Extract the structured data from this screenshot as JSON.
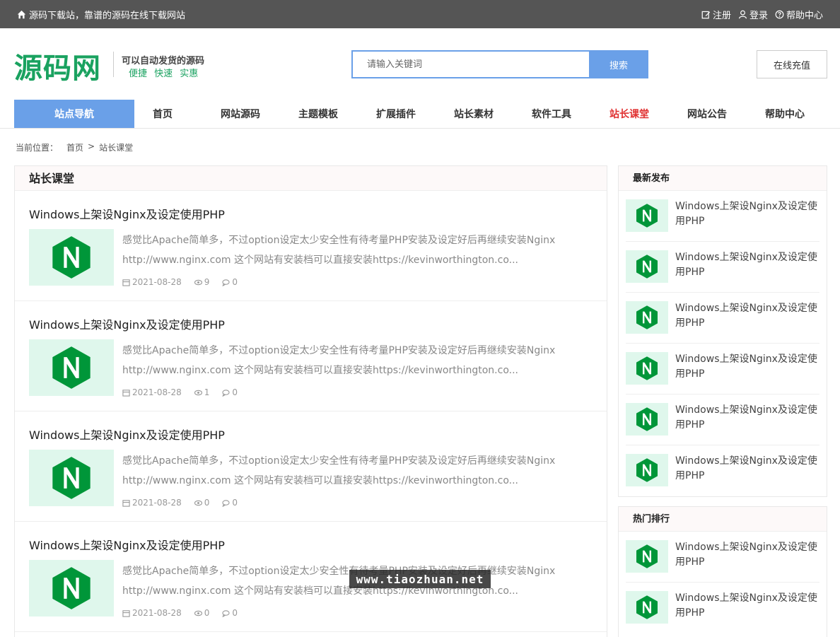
{
  "topbar": {
    "slogan": "源码下载站，靠谱的源码在线下载网站",
    "register": "注册",
    "login": "登录",
    "help": "帮助中心"
  },
  "header": {
    "logo": "源码网",
    "slogan_line1": "可以自动发货的源码",
    "slogan_line2": "便捷 快速 实惠",
    "search_placeholder": "请输入关键词",
    "search_button": "搜索",
    "recharge_button": "在线充值"
  },
  "nav": {
    "site_nav": "站点导航",
    "items": [
      "首页",
      "网站源码",
      "主题模板",
      "扩展插件",
      "站长素材",
      "软件工具",
      "站长课堂",
      "网站公告",
      "帮助中心"
    ],
    "active_index": 6,
    "active_color": "#e03030"
  },
  "breadcrumb": {
    "label": "当前位置：",
    "home": "首页",
    "separator": ">",
    "current": "站长课堂"
  },
  "main": {
    "title": "站长课堂",
    "posts": [
      {
        "title": "Windows上架设Nginx及设定使用PHP",
        "excerpt": "感觉比Apache简单多，不过option设定太少安全性有待考量PHP安装及设定好后再继续安装Nginx http://www.nginx.com 这个网站有安装档可以直接安装https://kevinworthington.co...",
        "date": "2021-08-28",
        "views": "9",
        "comments": "0"
      },
      {
        "title": "Windows上架设Nginx及设定使用PHP",
        "excerpt": "感觉比Apache简单多，不过option设定太少安全性有待考量PHP安装及设定好后再继续安装Nginx http://www.nginx.com 这个网站有安装档可以直接安装https://kevinworthington.co...",
        "date": "2021-08-28",
        "views": "1",
        "comments": "0"
      },
      {
        "title": "Windows上架设Nginx及设定使用PHP",
        "excerpt": "感觉比Apache简单多，不过option设定太少安全性有待考量PHP安装及设定好后再继续安装Nginx http://www.nginx.com 这个网站有安装档可以直接安装https://kevinworthington.co...",
        "date": "2021-08-28",
        "views": "0",
        "comments": "0"
      },
      {
        "title": "Windows上架设Nginx及设定使用PHP",
        "excerpt": "感觉比Apache简单多，不过option设定太少安全性有待考量PHP安装及设定好后再继续安装Nginx http://www.nginx.com 这个网站有安装档可以直接安装https://kevinworthington.co...",
        "date": "2021-08-28",
        "views": "0",
        "comments": "0"
      }
    ]
  },
  "sidebar": {
    "latest_title": "最新发布",
    "latest": [
      "Windows上架设Nginx及设定使用PHP",
      "Windows上架设Nginx及设定使用PHP",
      "Windows上架设Nginx及设定使用PHP",
      "Windows上架设Nginx及设定使用PHP",
      "Windows上架设Nginx及设定使用PHP",
      "Windows上架设Nginx及设定使用PHP"
    ],
    "hot_title": "热门排行",
    "hot": [
      "Windows上架设Nginx及设定使用PHP",
      "Windows上架设Nginx及设定使用PHP"
    ]
  },
  "watermark": "www.tiaozhuan.net",
  "colors": {
    "accent": "#6aa0e8",
    "brand_green": "#1aa260",
    "topbar": "#555555",
    "nginx_green": "#009639"
  },
  "icons": {
    "home": "home-icon",
    "register": "edit-icon",
    "login": "user-icon",
    "help": "question-circle-icon",
    "date": "calendar-icon",
    "views": "eye-icon",
    "comments": "comment-icon",
    "thumbnail": "nginx-logo-icon"
  }
}
